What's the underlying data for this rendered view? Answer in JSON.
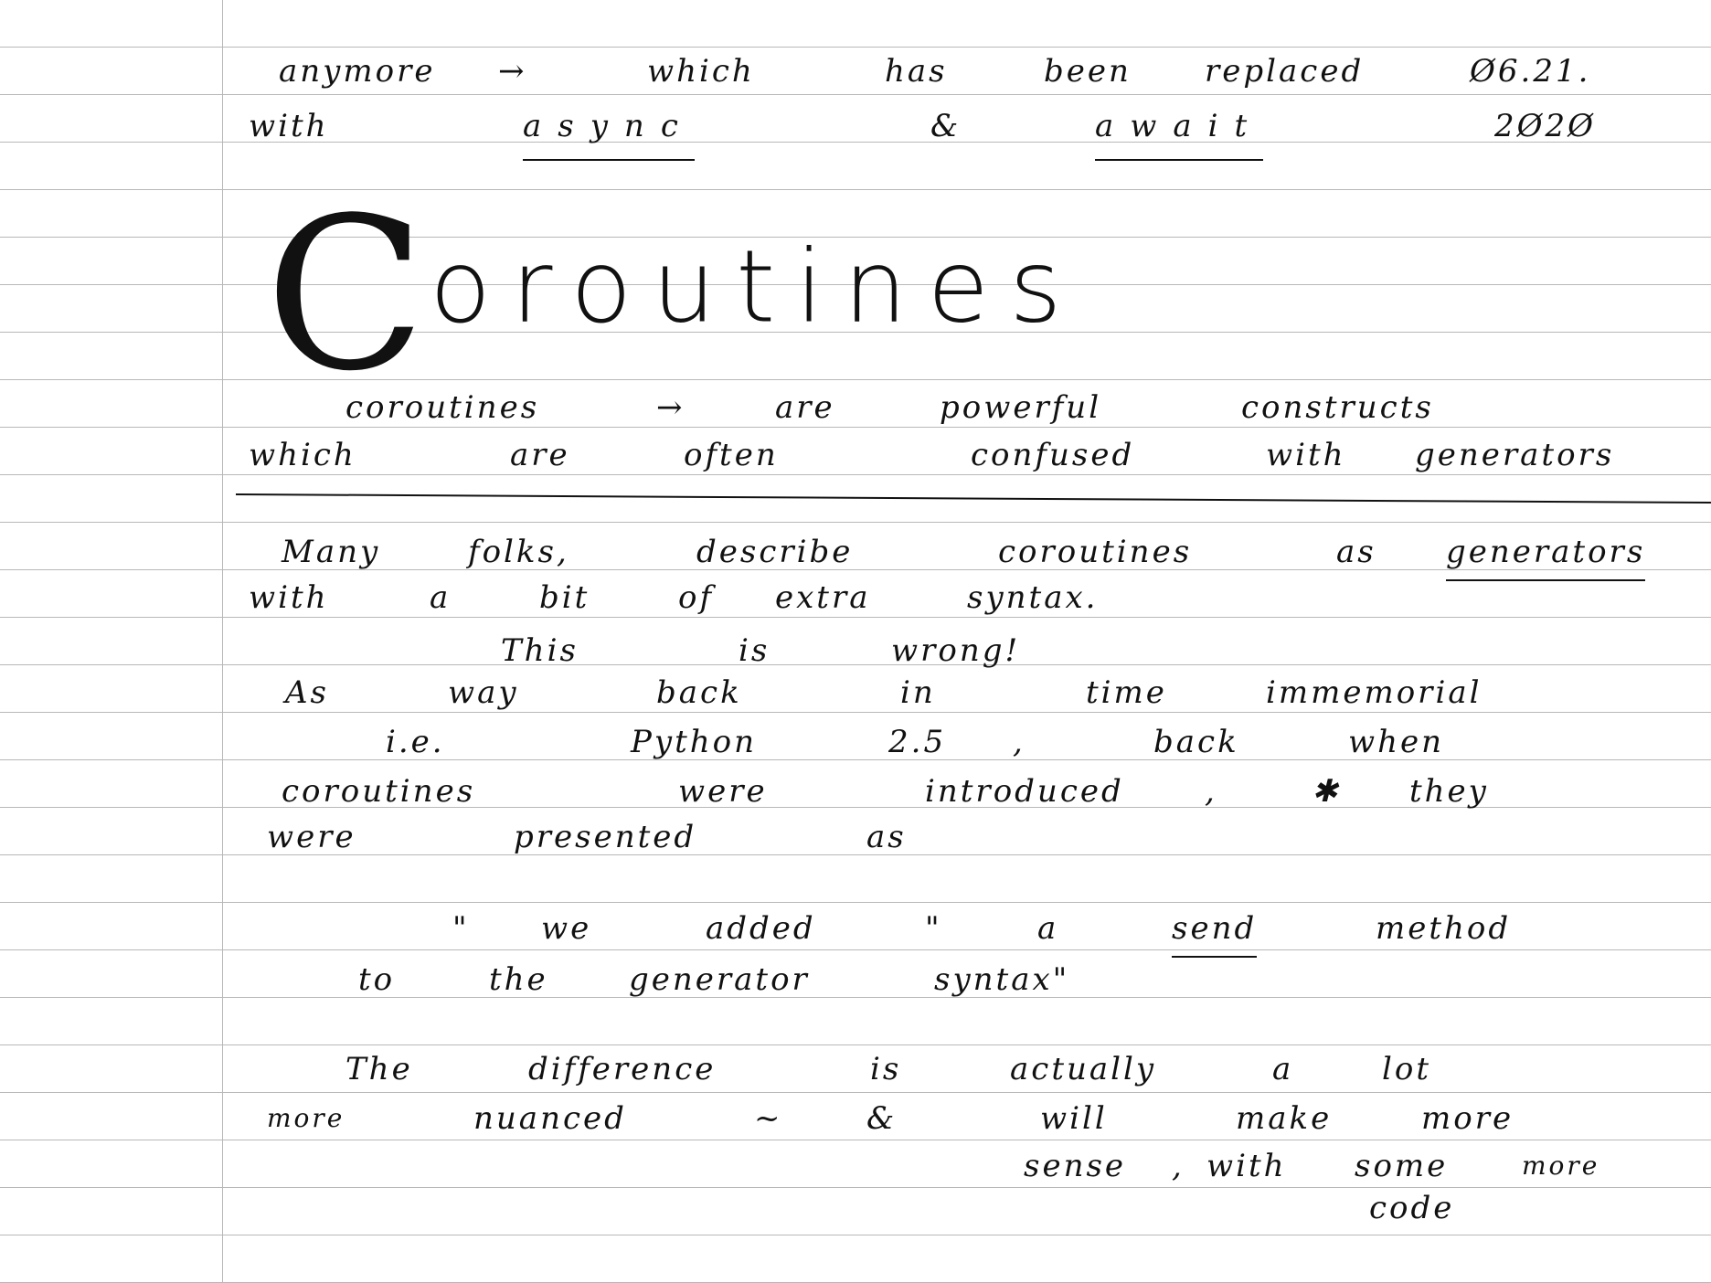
{
  "lines": {
    "l1": [
      "anymore",
      "→",
      "which",
      "has",
      "been",
      "replaced",
      "Ø6.21."
    ],
    "l2": [
      "with",
      "async",
      "&",
      "await",
      "2Ø2Ø"
    ],
    "title_initial": "C",
    "title_rest": "oroutines",
    "l3": [
      "coroutines",
      "→",
      "are",
      "powerful",
      "constructs"
    ],
    "l4": [
      "which",
      "are",
      "often",
      "confused",
      "with",
      "generators"
    ],
    "l5": [
      "Many",
      "folks,",
      "describe",
      "coroutines",
      "as",
      "generators"
    ],
    "l6": [
      "with",
      "a",
      "bit",
      "of",
      "extra",
      "syntax."
    ],
    "l7": [
      "This",
      "is",
      "wrong!"
    ],
    "l8": [
      "As",
      "way",
      "back",
      "in",
      "time",
      "immemorial"
    ],
    "l9": [
      "i.e.",
      "Python",
      "2.5",
      ",",
      "back",
      "when"
    ],
    "l10": [
      "coroutines",
      "were",
      "introduced",
      ",",
      "✱",
      "they"
    ],
    "l11": [
      "were",
      "presented",
      "as"
    ],
    "l12": [
      "\"",
      "we",
      "added",
      "\"",
      "a",
      "send",
      "method"
    ],
    "l13": [
      "to",
      "the",
      "generator",
      "syntax\""
    ],
    "l14": [
      "The",
      "difference",
      "is",
      "actually",
      "a",
      "lot"
    ],
    "l15": [
      "more",
      "nuanced",
      "~",
      "&",
      "will",
      "make",
      "more"
    ],
    "l16": [
      "sense",
      ",",
      "with",
      "some",
      "more"
    ],
    "l17": [
      "code"
    ]
  }
}
